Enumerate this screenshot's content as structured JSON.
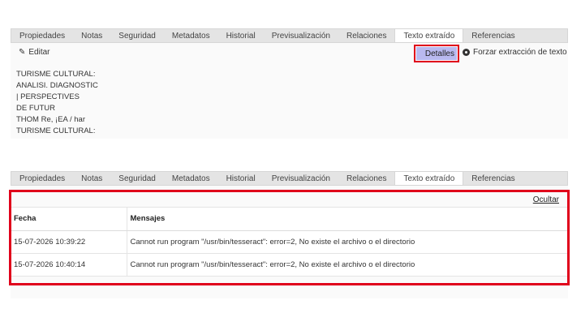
{
  "tabs": [
    "Propiedades",
    "Notas",
    "Seguridad",
    "Metadatos",
    "Historial",
    "Previsualización",
    "Relaciones",
    "Texto extraído",
    "Referencias"
  ],
  "active_tab": "Texto extraído",
  "toolbar": {
    "edit_label": "Editar",
    "details_label": "Detalles",
    "force_label": "Forzar extracción de texto"
  },
  "extracted_text": [
    "TURISME CULTURAL:",
    "ANALISI. DIAGNOSTIC",
    "| PERSPECTIVES",
    "DE FUTUR",
    "THOM Re, ¡EA / har",
    "TURISME CULTURAL:"
  ],
  "details": {
    "hide_label": "Ocultar",
    "columns": [
      "Fecha",
      "Mensajes"
    ],
    "rows": [
      {
        "date": "15-07-2026 10:39:22",
        "message": "Cannot run program \"/usr/bin/tesseract\": error=2, No existe el archivo o el directorio"
      },
      {
        "date": "15-07-2026 10:40:14",
        "message": "Cannot run program \"/usr/bin/tesseract\": error=2, No existe el archivo o el directorio"
      }
    ]
  },
  "colors": {
    "highlight": "#e0001b",
    "details_button": "#b9b9f0"
  }
}
